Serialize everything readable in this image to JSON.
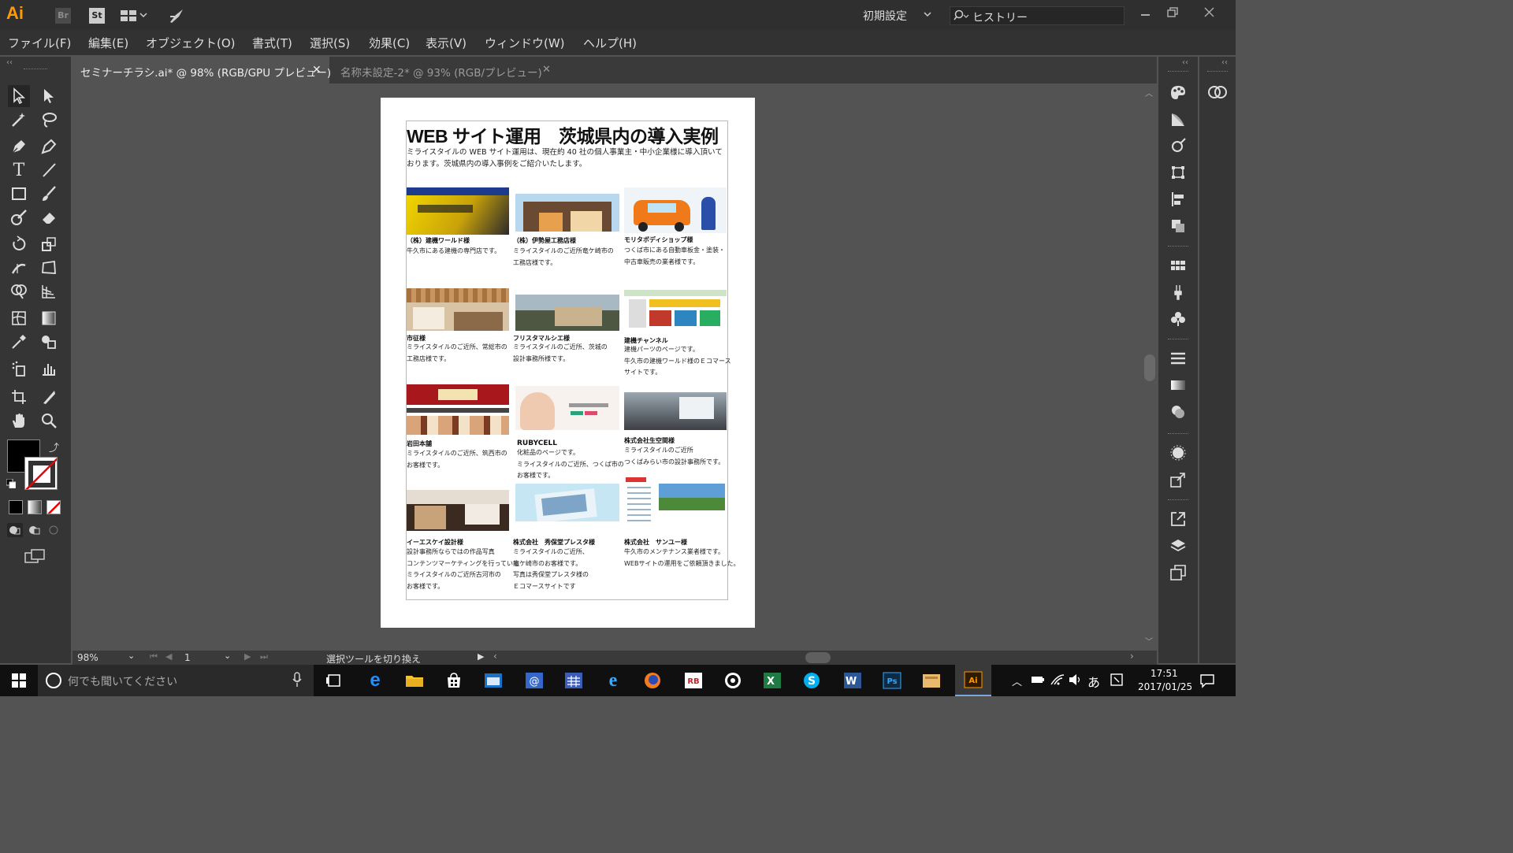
{
  "app": {
    "logo": "Ai",
    "br_label": "Br",
    "st_label": "St",
    "workspace_label": "初期設定",
    "search_placeholder": "ヒストリー"
  },
  "menu": [
    "ファイル(F)",
    "編集(E)",
    "オブジェクト(O)",
    "書式(T)",
    "選択(S)",
    "効果(C)",
    "表示(V)",
    "ウィンドウ(W)",
    "ヘルプ(H)"
  ],
  "tabs": [
    {
      "label": "セミナーチラシ.ai* @ 98% (RGB/GPU プレビュー)",
      "active": true
    },
    {
      "label": "名称未設定-2* @ 93% (RGB/プレビュー)",
      "active": false
    }
  ],
  "document": {
    "title": "WEB サイト運用　茨城県内の導入実例",
    "intro": "ミライスタイルの WEB サイト運用は、現在約 40 社の個人事業主・中小企業様に導入頂いております。茨城県内の導入事例をご紹介いたします。",
    "cases": [
      {
        "name": "（株）建機ワールド様",
        "desc": "牛久市にある建機の専門店です。"
      },
      {
        "name": "（株）伊勢屋工務店様",
        "desc": "ミライスタイルのご近所竜ケ崎市の\n工務店様です。"
      },
      {
        "name": "モリタボディショップ様",
        "desc": "つくば市にある自動車板金・塗装・\n中古車販売の業者様です。"
      },
      {
        "name": "市征様",
        "desc": "ミライスタイルのご近所、常総市の\n工務店様です。"
      },
      {
        "name": "フリスタマルシエ様",
        "desc": "ミライスタイルのご近所、茨城の\n設計事務所様です。"
      },
      {
        "name": "建機チャンネル",
        "desc": "建機パーツのページです。\n牛久市の建機ワールド様のＥコマース\nサイトです。"
      },
      {
        "name": "岩田本舗",
        "desc": "ミライスタイルのご近所、筑西市の\nお客様です。"
      },
      {
        "name": "RUBYCELL",
        "desc": "化粧品のページです。\nミライスタイルのご近所、つくば市の\nお客様です。"
      },
      {
        "name": "株式会社生空間様",
        "desc": "ミライスタイルのご近所\nつくばみらい市の設計事務所です。"
      },
      {
        "name": "イーエスケイ設計様",
        "desc": "設計事務所ならではの作品写真\nコンテンツマーケティングを行っている\nミライスタイルのご近所古河市の\nお客様です。"
      },
      {
        "name": "株式会社　秀保堂プレスタ様",
        "desc": "ミライスタイルのご近所、\n龍ケ崎市のお客様です。\n写真は秀保堂プレスタ様の\nＥコマースサイトです"
      },
      {
        "name": "株式会社　サンユー様",
        "desc": "牛久市のメンテナンス業者様です。\nWEBサイトの運用をご依頼頂きました。"
      }
    ]
  },
  "statusbar": {
    "zoom": "98%",
    "page": "1",
    "status_text": "選択ツールを切り換え"
  },
  "taskbar": {
    "search_placeholder": "何でも聞いてください",
    "ime": "あ",
    "time": "17:51",
    "date": "2017/01/25",
    "apps": [
      "edge",
      "explorer",
      "store",
      "app-window",
      "mail",
      "calendar",
      "ie",
      "firefox",
      "app-rb",
      "media",
      "excel",
      "skype",
      "word",
      "photoshop",
      "app-folder",
      "illustrator"
    ]
  },
  "colors": {
    "accent": "#ff9a00",
    "guide": "#6fd6e6",
    "bg": "#535353"
  }
}
